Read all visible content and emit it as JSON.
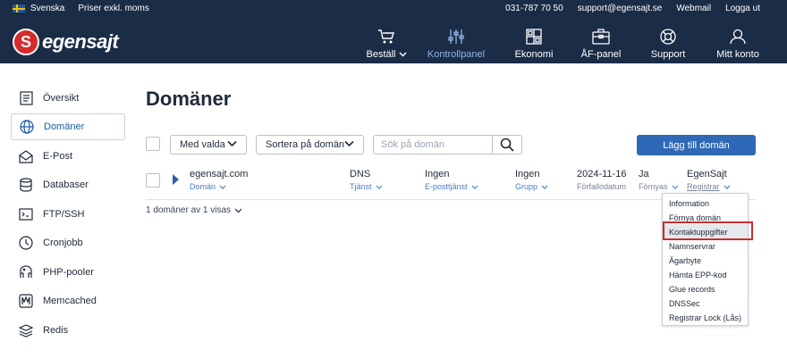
{
  "topbar": {
    "language": "Svenska",
    "prices": "Priser exkl. moms",
    "phone": "031-787 70 50",
    "email": "support@egensajt.se",
    "webmail": "Webmail",
    "logout": "Logga ut"
  },
  "brand": {
    "logo_letter": "S",
    "name": "egensajt"
  },
  "nav": {
    "order": "Beställ",
    "control_panel": "Kontrollpanel",
    "economy": "Ekonomi",
    "af_panel": "ÅF-panel",
    "support": "Support",
    "account": "Mitt konto"
  },
  "sidebar": {
    "items": [
      {
        "label": "Översikt",
        "icon": "document-icon"
      },
      {
        "label": "Domäner",
        "icon": "globe-icon"
      },
      {
        "label": "E-Post",
        "icon": "mail-icon"
      },
      {
        "label": "Databaser",
        "icon": "database-icon"
      },
      {
        "label": "FTP/SSH",
        "icon": "terminal-icon"
      },
      {
        "label": "Cronjobb",
        "icon": "clock-icon"
      },
      {
        "label": "PHP-pooler",
        "icon": "php-icon"
      },
      {
        "label": "Memcached",
        "icon": "memcached-icon"
      },
      {
        "label": "Redis",
        "icon": "redis-icon"
      }
    ]
  },
  "page": {
    "title": "Domäner"
  },
  "toolbar": {
    "bulk_action": "Med valda",
    "sort": "Sortera på domän",
    "search_placeholder": "Sök på domän",
    "add_domain": "Lägg till domän"
  },
  "table": {
    "row": {
      "domain": "egensajt.com",
      "domain_label": "Domän",
      "service": "DNS",
      "service_label": "Tjänst",
      "email_service": "Ingen",
      "email_service_label": "E-posttjänst",
      "group": "Ingen",
      "group_label": "Grupp",
      "expiry": "2024-11-16",
      "expiry_label": "Förfallodatum",
      "renew": "Ja",
      "renew_label": "Förnyas",
      "registrar": "EgenSajt",
      "registrar_label": "Registrar"
    },
    "count_text": "1 domäner av 1 visas"
  },
  "registrar_menu": {
    "items": [
      "Information",
      "Förnya domän",
      "Kontaktuppgifter",
      "Namnservrar",
      "Ägarbyte",
      "Hämta EPP-kod",
      "Glue records",
      "DNSSec",
      "Registrar Lock (Lås)"
    ],
    "highlighted": "Kontaktuppgifter"
  },
  "colors": {
    "header_bg": "#1b2c46",
    "accent": "#2f68b6",
    "highlight_border": "#d02b2b"
  }
}
